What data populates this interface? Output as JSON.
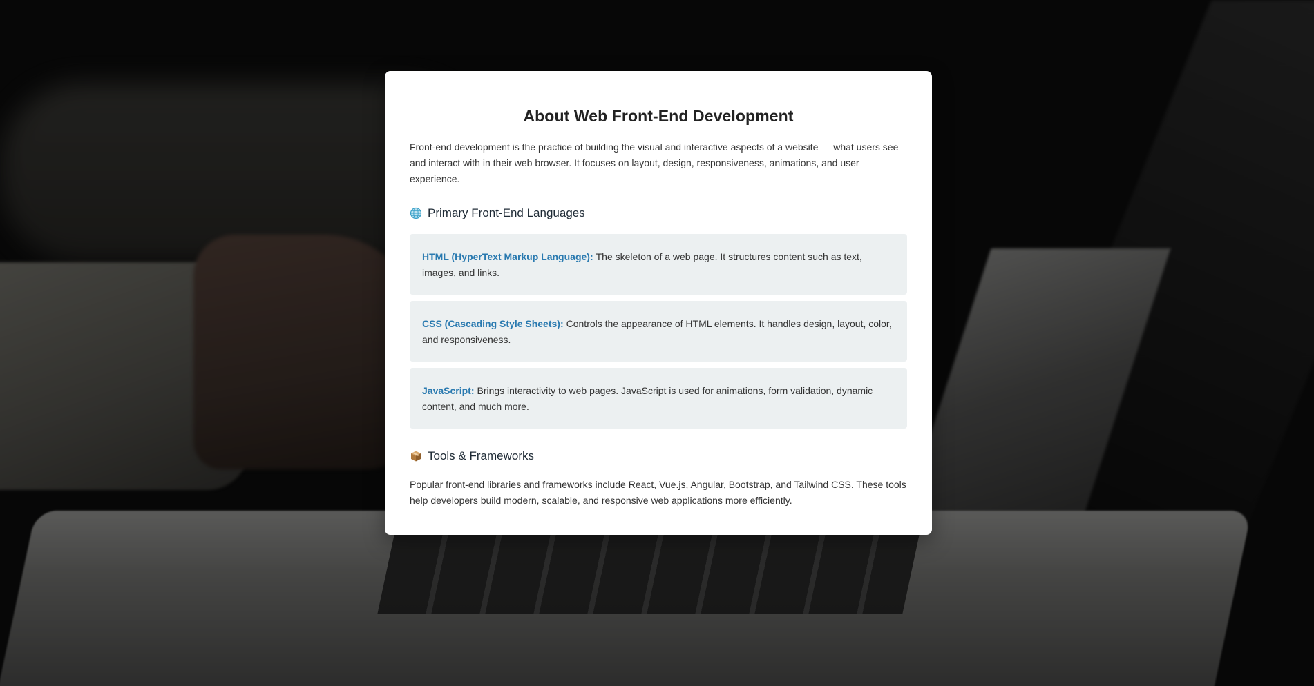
{
  "page": {
    "title": "About Web Front-End Development",
    "intro": "Front-end development is the practice of building the visual and interactive aspects of a website — what users see and interact with in their web browser. It focuses on layout, design, responsiveness, animations, and user experience."
  },
  "languages_section": {
    "icon": "globe-icon",
    "heading": "Primary Front-End Languages",
    "items": [
      {
        "name": "HTML (HyperText Markup Language):",
        "description": "The skeleton of a web page. It structures content such as text, images, and links."
      },
      {
        "name": "CSS (Cascading Style Sheets):",
        "description": "Controls the appearance of HTML elements. It handles design, layout, color, and responsiveness."
      },
      {
        "name": "JavaScript:",
        "description": "Brings interactivity to web pages. JavaScript is used for animations, form validation, dynamic content, and much more."
      }
    ]
  },
  "tools_section": {
    "icon": "package-icon",
    "heading": "Tools & Frameworks",
    "text": "Popular front-end libraries and frameworks include React, Vue.js, Angular, Bootstrap, and Tailwind CSS. These tools help developers build modern, scalable, and responsive web applications more efficiently."
  },
  "colors": {
    "accent": "#2a7ab0",
    "card_background": "#ffffff",
    "box_background": "#ecf0f1",
    "text": "#333333"
  }
}
